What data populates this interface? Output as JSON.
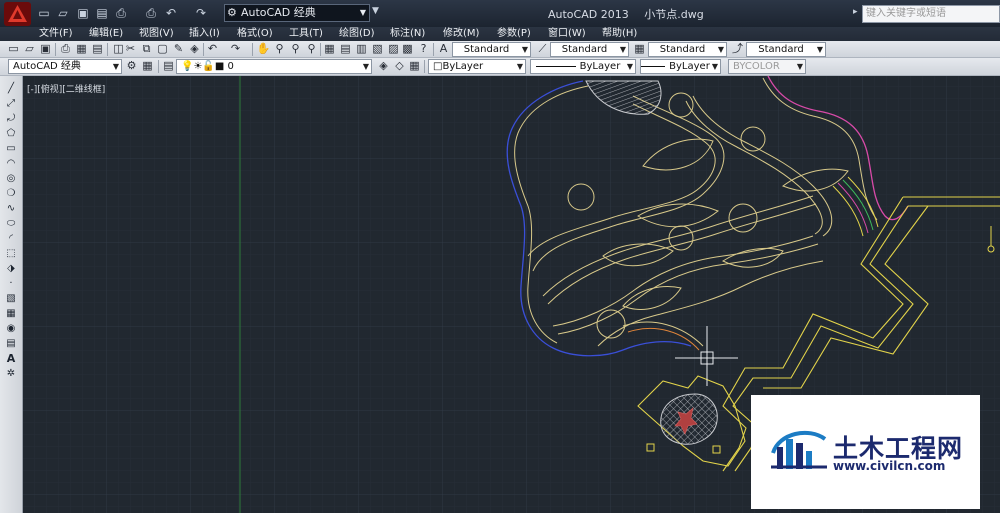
{
  "title_bar": {
    "app_name": "AutoCAD 2013",
    "file_name": "小节点.dwg",
    "workspace": "AutoCAD 经典",
    "search_placeholder": "键入关键字或短语",
    "quick_access_icons": [
      "new-icon",
      "open-icon",
      "save-icon",
      "save-as-icon",
      "publish-icon",
      "plot-icon",
      "undo-icon",
      "redo-icon"
    ]
  },
  "menu": [
    "文件(F)",
    "编辑(E)",
    "视图(V)",
    "插入(I)",
    "格式(O)",
    "工具(T)",
    "绘图(D)",
    "标注(N)",
    "修改(M)",
    "参数(P)",
    "窗口(W)",
    "帮助(H)"
  ],
  "toolbar_standard": {
    "text_style": "Standard",
    "dim_style": "Standard",
    "table_style": "Standard",
    "multileader_style": "Standard"
  },
  "toolbar_layers": {
    "workspace": "AutoCAD 经典",
    "current_layer": "0",
    "color": "ByLayer",
    "linetype": "ByLayer",
    "lineweight": "ByLayer",
    "plot_style": "BYCOLOR"
  },
  "viewport": {
    "label": "[-][俯视][二维线框]"
  },
  "draw_tools": [
    "line-icon",
    "construction-line-icon",
    "polyline-icon",
    "polygon-icon",
    "rectangle-icon",
    "arc-icon",
    "circle-icon",
    "revision-cloud-icon",
    "spline-icon",
    "ellipse-icon",
    "ellipse-arc-icon",
    "insert-block-icon",
    "make-block-icon",
    "point-icon",
    "hatch-icon",
    "gradient-icon",
    "region-icon",
    "table-icon",
    "mtext-icon",
    "add-selected-icon"
  ],
  "watermark": {
    "title": "土木工程网",
    "url": "www.civilcn.com"
  },
  "colors": {
    "canvas": "#212830",
    "grid": "#2c3540",
    "path_yellow": "#d8c98a",
    "boundary_blue": "#3a4fd8",
    "boundary_magenta": "#d84aa8",
    "zigzag_yellow": "#e2d34a",
    "watermark_blue": "#1c2a6e"
  }
}
